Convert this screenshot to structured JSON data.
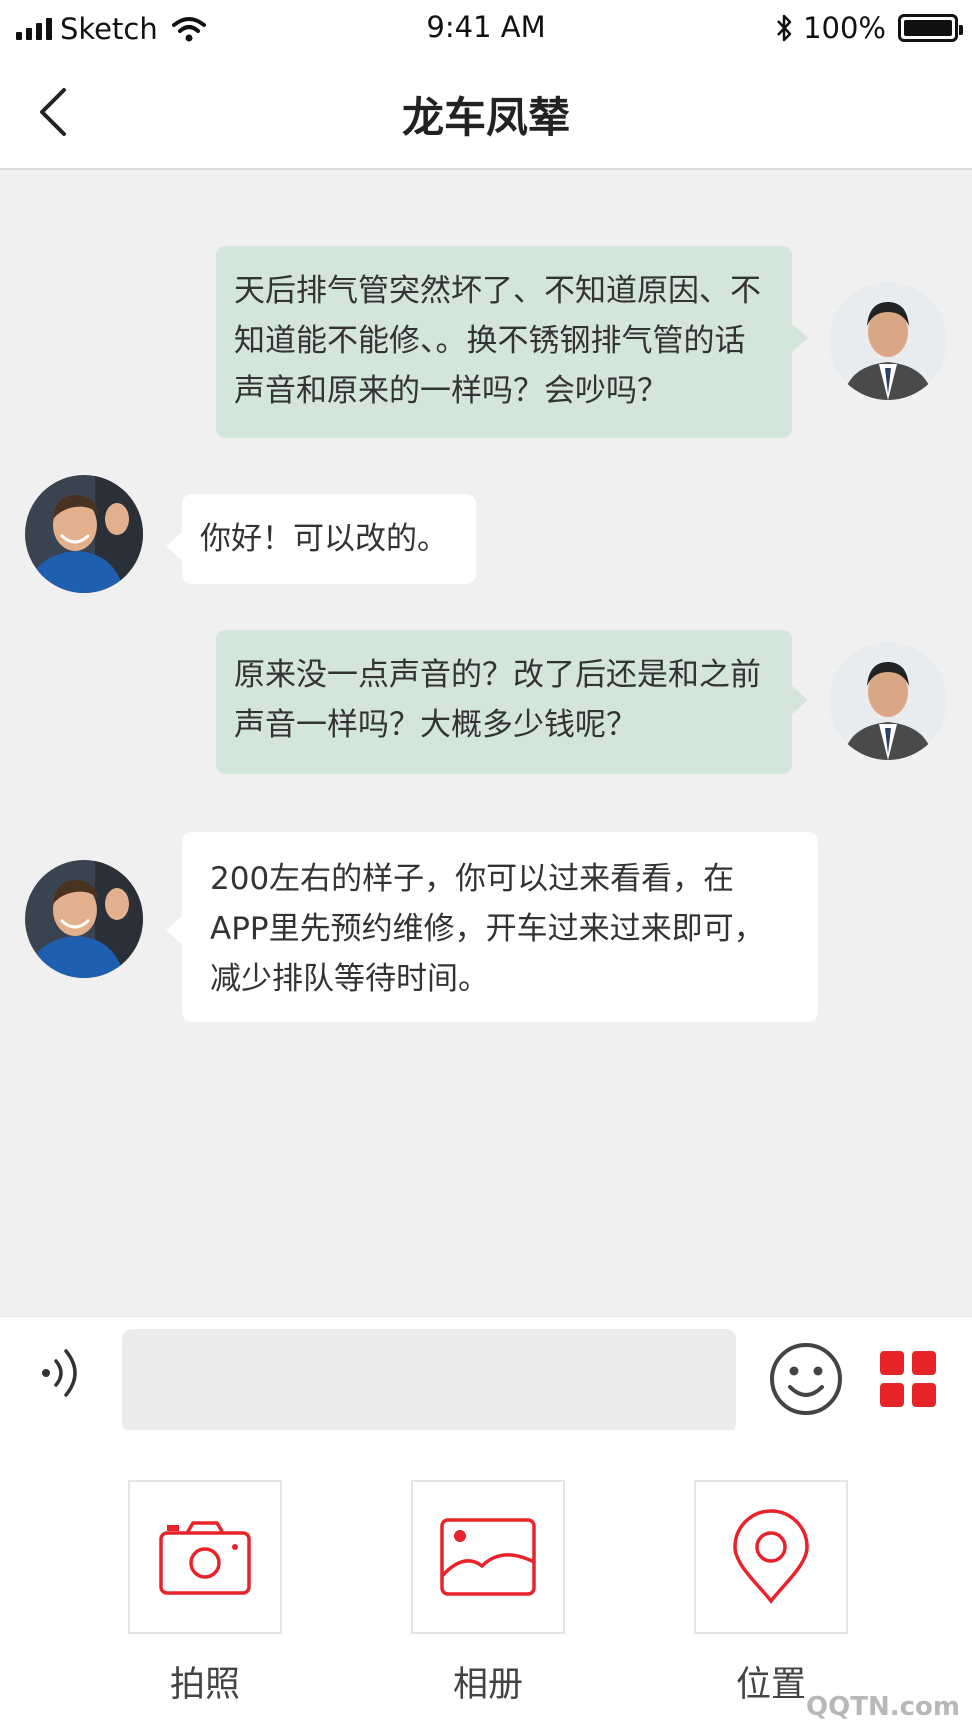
{
  "status_bar": {
    "carrier": "Sketch",
    "time": "9:41 AM",
    "battery": "100%",
    "icons": [
      "signal-icon",
      "wifi-icon",
      "bluetooth-icon",
      "battery-icon"
    ]
  },
  "nav": {
    "title": "龙车凤辇",
    "back_icon": "chevron-left-icon"
  },
  "messages": [
    {
      "side": "right",
      "text": "天后排气管突然坏了、不知道原因、不知道能不能修、。换不锈钢排气管的话声音和原来的一样吗？会吵吗？"
    },
    {
      "side": "left",
      "text": "你好！可以改的。"
    },
    {
      "side": "right",
      "text": "原来没一点声音的？改了后还是和之前声音一样吗？大概多少钱呢？"
    },
    {
      "side": "left",
      "text": "200左右的样子，你可以过来看看，在APP里先预约维修，开车过来过来即可，减少排队等待时间。"
    }
  ],
  "input": {
    "value": "",
    "placeholder": ""
  },
  "tools": [
    {
      "label": "拍照",
      "icon": "camera-icon"
    },
    {
      "label": "相册",
      "icon": "image-icon"
    },
    {
      "label": "位置",
      "icon": "location-pin-icon"
    }
  ],
  "colors": {
    "sent_bubble": "#d4e5dc",
    "received_bubble": "#ffffff",
    "chat_background": "#f0f0f0",
    "accent": "#e8232a"
  },
  "watermark": "QQTN.com"
}
